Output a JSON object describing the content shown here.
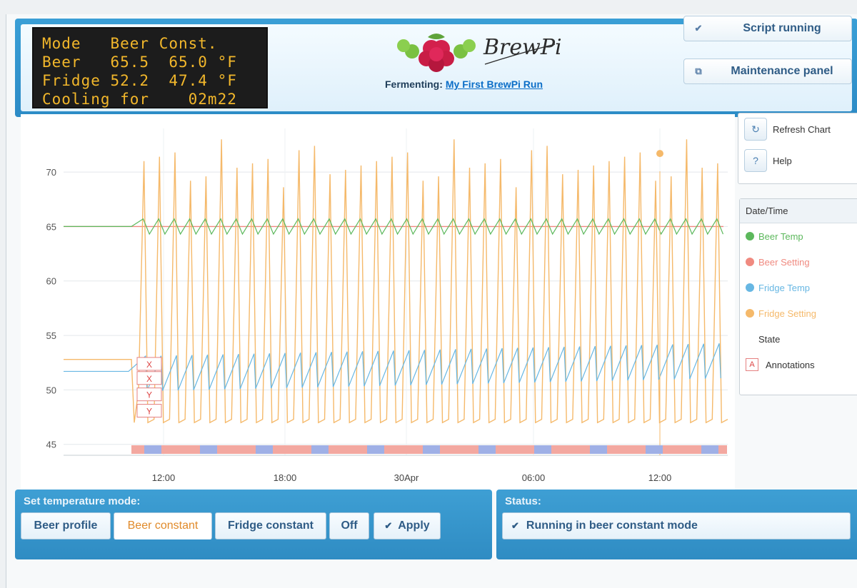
{
  "lcd": {
    "line1": "Mode   Beer Const.",
    "line2": "Beer   65.5  65.0 °F",
    "line3": "Fridge 52.2  47.4 °F",
    "line4": "Cooling for    02m22"
  },
  "logo": {
    "text": "BrewPi"
  },
  "fermenting": {
    "label": "Fermenting:",
    "name": "My First BrewPi Run"
  },
  "header_buttons": {
    "script_running": "Script running",
    "maintenance": "Maintenance panel"
  },
  "side_buttons": {
    "refresh": "Refresh Chart",
    "help": "Help"
  },
  "legend": {
    "header": "Date/Time",
    "items": [
      {
        "label": "Beer Temp",
        "color": "#5cb85c"
      },
      {
        "label": "Beer Setting",
        "color": "#f08a80"
      },
      {
        "label": "Fridge Temp",
        "color": "#67b7e3"
      },
      {
        "label": "Fridge Setting",
        "color": "#f5b96a"
      },
      {
        "label": "State",
        "color": ""
      },
      {
        "label": "Annotations",
        "color": "#e06060"
      }
    ]
  },
  "controls": {
    "title": "Set temperature mode:",
    "buttons": [
      "Beer profile",
      "Beer constant",
      "Fridge constant",
      "Off"
    ],
    "apply": "Apply"
  },
  "status": {
    "title": "Status:",
    "text": "Running in beer constant mode"
  },
  "chart_data": {
    "type": "line",
    "ylim": [
      44,
      74
    ],
    "yticks": [
      45,
      50,
      55,
      60,
      65,
      70
    ],
    "xtick_labels": [
      "12:00",
      "18:00",
      "30Apr",
      "06:00",
      "12:00"
    ],
    "annotations": [
      "X",
      "X",
      "Y",
      "Y"
    ],
    "series": [
      {
        "name": "Beer Temp",
        "color": "#5cb85c",
        "base": 65.0,
        "amp": 0.7
      },
      {
        "name": "Beer Setting",
        "color": "#f08a80",
        "constant": 65.0
      },
      {
        "name": "Fridge Temp",
        "color": "#67b7e3",
        "base": 51.5,
        "amp": 1.6
      },
      {
        "name": "Fridge Setting",
        "color": "#f5b96a",
        "high": 71,
        "low": 47
      }
    ],
    "colors": {
      "state_a": "#f3a8a0",
      "state_b": "#9fb0e6"
    }
  }
}
